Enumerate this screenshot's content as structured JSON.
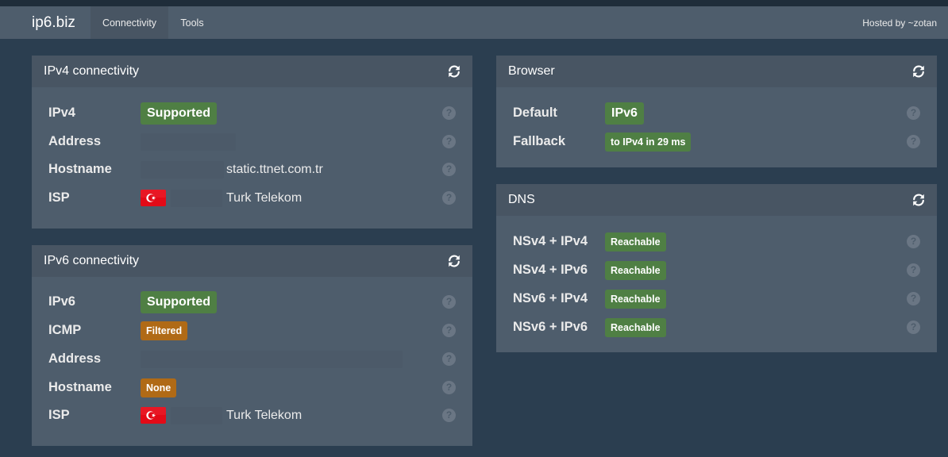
{
  "navbar": {
    "brand": "ip6.biz",
    "tabs": [
      {
        "label": "Connectivity",
        "active": true
      },
      {
        "label": "Tools",
        "active": false
      }
    ],
    "hosted_by": "Hosted by ~zotan"
  },
  "colors": {
    "background": "#2b3e50",
    "panel": "#4e5d6c",
    "success": "#4f7f44",
    "warning": "#b06a16"
  },
  "ipv4": {
    "title": "IPv4 connectivity",
    "rows": [
      {
        "label": "IPv4",
        "badge": "Supported",
        "badge_color": "green"
      },
      {
        "label": "Address"
      },
      {
        "label": "Hostname",
        "value": "static.ttnet.com.tr"
      },
      {
        "label": "ISP",
        "flag": "turkey-flag-icon",
        "value": "Turk Telekom"
      }
    ]
  },
  "ipv6": {
    "title": "IPv6 connectivity",
    "rows": [
      {
        "label": "IPv6",
        "badge": "Supported",
        "badge_color": "green"
      },
      {
        "label": "ICMP",
        "badge": "Filtered",
        "badge_color": "orange"
      },
      {
        "label": "Address"
      },
      {
        "label": "Hostname",
        "badge": "None",
        "badge_color": "orange"
      },
      {
        "label": "ISP",
        "flag": "turkey-flag-icon",
        "value": "Turk Telekom"
      }
    ]
  },
  "browser": {
    "title": "Browser",
    "rows": [
      {
        "label": "Default",
        "badge": "IPv6",
        "badge_color": "green"
      },
      {
        "label": "Fallback",
        "badge": "to IPv4 in 29 ms",
        "badge_color": "green"
      }
    ]
  },
  "dns": {
    "title": "DNS",
    "rows": [
      {
        "label": "NSv4 + IPv4",
        "badge": "Reachable",
        "badge_color": "green"
      },
      {
        "label": "NSv4 + IPv6",
        "badge": "Reachable",
        "badge_color": "green"
      },
      {
        "label": "NSv6 + IPv4",
        "badge": "Reachable",
        "badge_color": "green"
      },
      {
        "label": "NSv6 + IPv6",
        "badge": "Reachable",
        "badge_color": "green"
      }
    ]
  },
  "help_glyph": "?"
}
